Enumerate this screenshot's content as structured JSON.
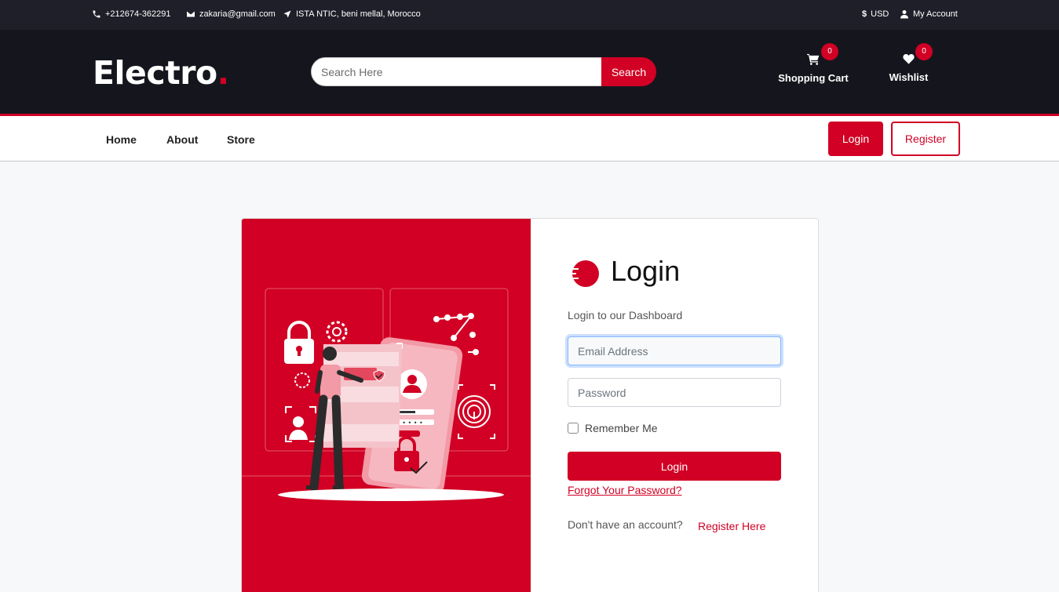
{
  "topbar": {
    "phone": "+212674-362291",
    "email": "zakaria@gmail.com",
    "address": "ISTA NTIC, beni mellal, Morocco",
    "currency": "USD",
    "account": "My Account"
  },
  "header": {
    "logo_text": "Electro",
    "logo_dot": ".",
    "search_placeholder": "Search Here",
    "search_button": "Search",
    "cart_label": "Shopping Cart",
    "cart_count": "0",
    "wishlist_label": "Wishlist",
    "wishlist_count": "0"
  },
  "nav": {
    "links": [
      "Home",
      "About",
      "Store"
    ],
    "login_button": "Login",
    "register_button": "Register"
  },
  "form": {
    "title": "Login",
    "subtitle": "Login to our Dashboard",
    "email_placeholder": "Email Address",
    "password_placeholder": "Password",
    "remember_label": "Remember Me",
    "login_button": "Login",
    "forgot_link": "Forgot Your Password?",
    "no_account_text": "Don't have an account?",
    "register_link": "Register Here"
  },
  "colors": {
    "accent": "#d10024",
    "topbar_bg": "#1e1f29",
    "header_bg": "#15161d"
  },
  "icons": [
    "phone-icon",
    "envelope-icon",
    "location-arrow-icon",
    "dollar-icon",
    "user-icon",
    "cart-icon",
    "heart-icon"
  ]
}
